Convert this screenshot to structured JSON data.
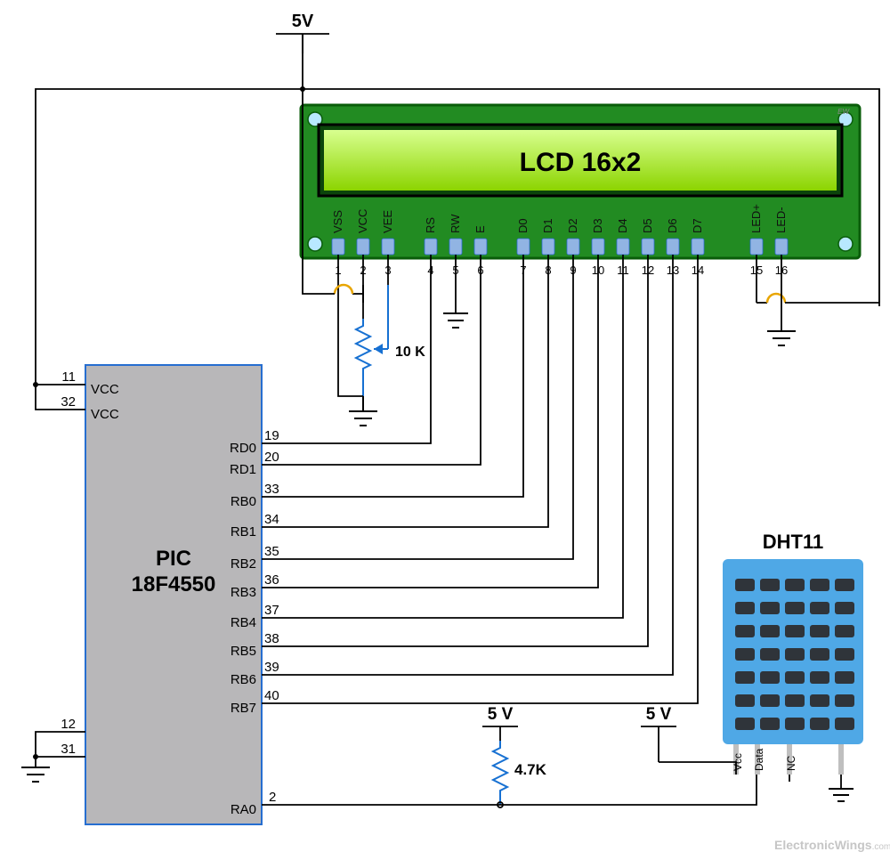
{
  "labels": {
    "v5_top": "5V",
    "v5_mid": "5 V",
    "v5_dht": "5 V",
    "mcu_line1": "PIC",
    "mcu_line2": "18F4550",
    "lcd_text": "LCD 16x2",
    "dht_title": "DHT11",
    "pot_value": "10 K",
    "res_value": "4.7K",
    "watermark": "ElectronicWings",
    "watermark2": ".com",
    "ew_small": "EW"
  },
  "mcu_left_pins": [
    {
      "num": "11",
      "name": "VCC"
    },
    {
      "num": "32",
      "name": "VCC"
    },
    {
      "num": "12",
      "name": ""
    },
    {
      "num": "31",
      "name": ""
    }
  ],
  "mcu_right_pins": [
    {
      "num": "19",
      "name": "RD0"
    },
    {
      "num": "20",
      "name": "RD1"
    },
    {
      "num": "33",
      "name": "RB0"
    },
    {
      "num": "34",
      "name": "RB1"
    },
    {
      "num": "35",
      "name": "RB2"
    },
    {
      "num": "36",
      "name": "RB3"
    },
    {
      "num": "37",
      "name": "RB4"
    },
    {
      "num": "38",
      "name": "RB5"
    },
    {
      "num": "39",
      "name": "RB6"
    },
    {
      "num": "40",
      "name": "RB7"
    },
    {
      "num": "2",
      "name": "RA0"
    }
  ],
  "lcd_pins": [
    {
      "num": "1",
      "name": "VSS"
    },
    {
      "num": "2",
      "name": "VCC"
    },
    {
      "num": "3",
      "name": "VEE"
    },
    {
      "num": "4",
      "name": "RS"
    },
    {
      "num": "5",
      "name": "RW"
    },
    {
      "num": "6",
      "name": "E"
    },
    {
      "num": "7",
      "name": "D0"
    },
    {
      "num": "8",
      "name": "D1"
    },
    {
      "num": "9",
      "name": "D2"
    },
    {
      "num": "10",
      "name": "D3"
    },
    {
      "num": "11",
      "name": "D4"
    },
    {
      "num": "12",
      "name": "D5"
    },
    {
      "num": "13",
      "name": "D6"
    },
    {
      "num": "14",
      "name": "D7"
    },
    {
      "num": "15",
      "name": "LED+"
    },
    {
      "num": "16",
      "name": "LED-"
    }
  ],
  "dht_pins": [
    {
      "name": "Vcc"
    },
    {
      "name": "Data"
    },
    {
      "name": "NC"
    },
    {
      "name": ""
    }
  ]
}
